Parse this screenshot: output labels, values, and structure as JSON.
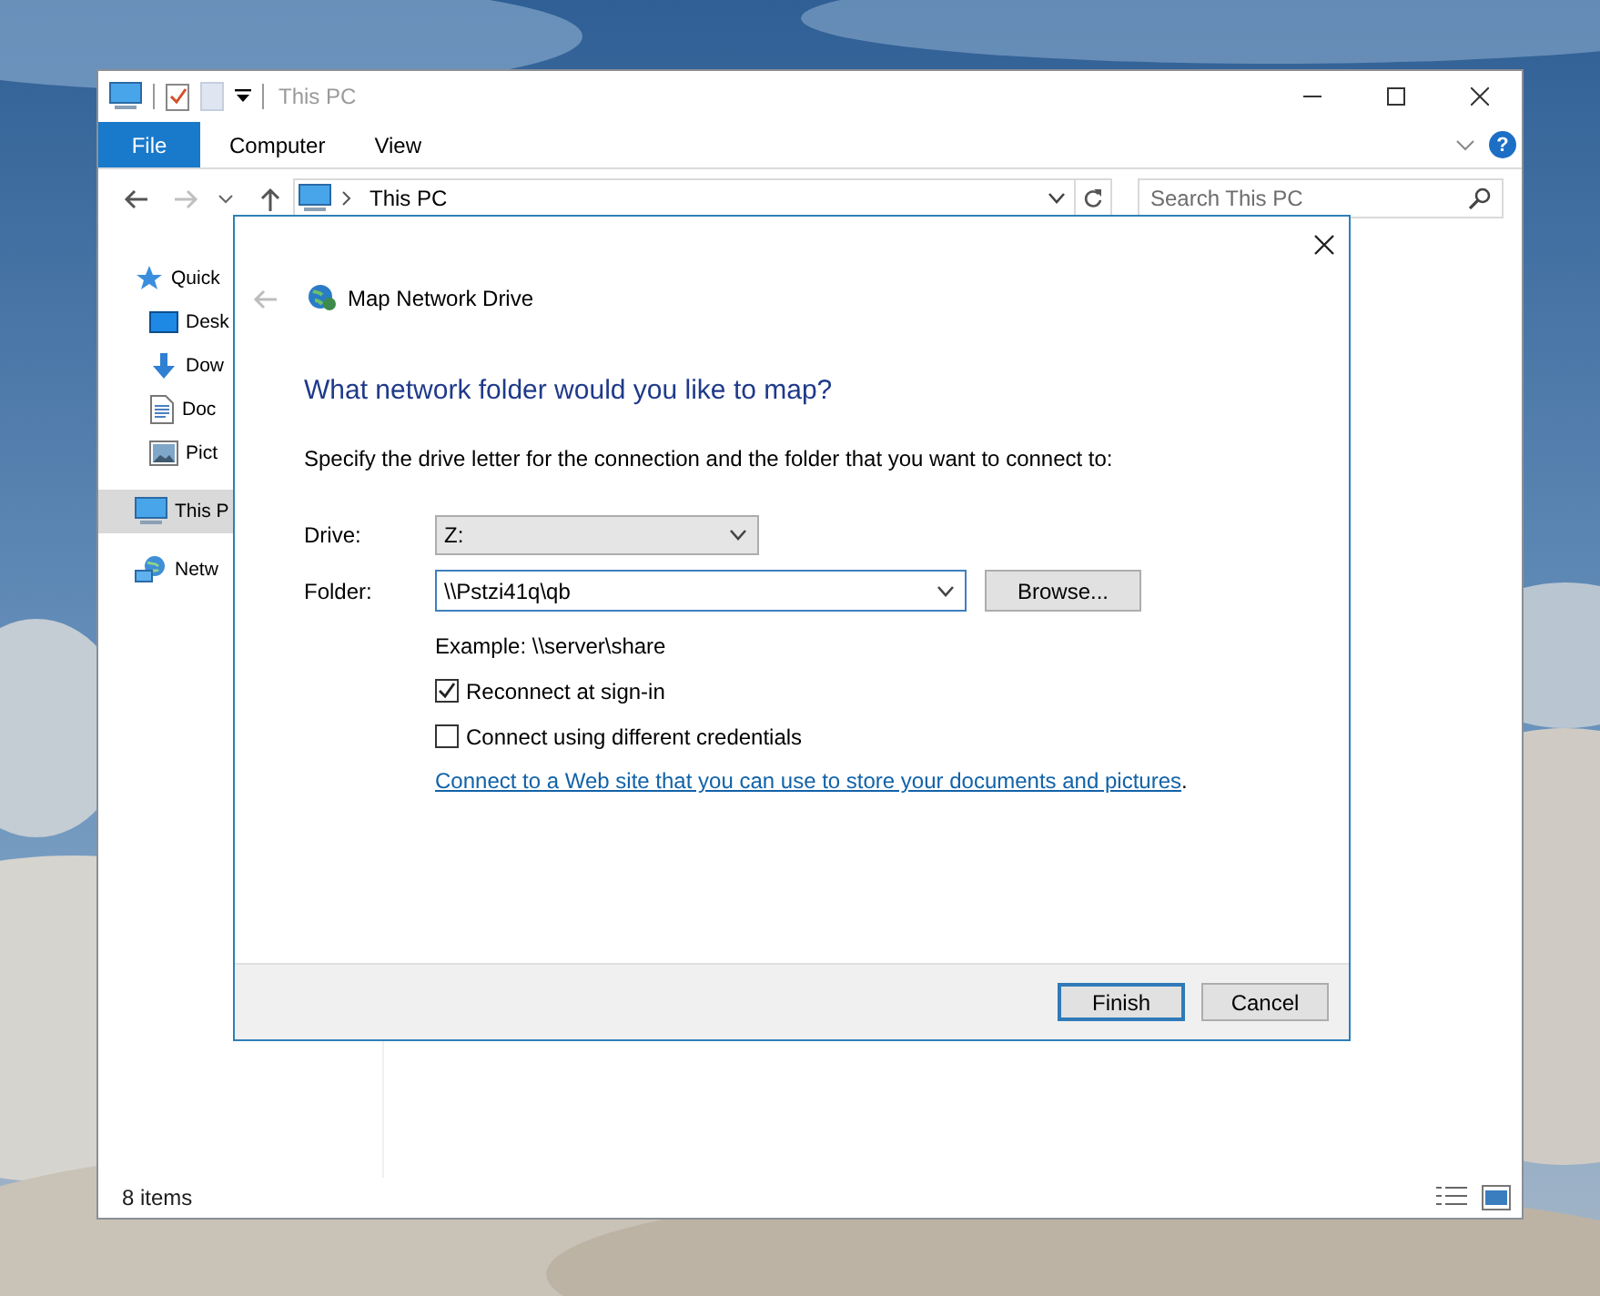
{
  "window": {
    "title": "This PC",
    "ribbon_tabs": [
      {
        "label": "File",
        "kind": "backstage"
      },
      {
        "label": "Computer",
        "kind": "tab"
      },
      {
        "label": "View",
        "kind": "tab"
      }
    ],
    "help": "?",
    "address": {
      "location": "This PC"
    },
    "search": {
      "placeholder": "Search This PC"
    },
    "sidebar": {
      "items": [
        {
          "label": "Quick",
          "kind": "quick",
          "selected": false,
          "children": [
            {
              "label": "Desk",
              "kind": "desktop",
              "selected": false
            },
            {
              "label": "Dow",
              "kind": "downloads",
              "selected": false
            },
            {
              "label": "Doc",
              "kind": "documents",
              "selected": false
            },
            {
              "label": "Pict",
              "kind": "pictures",
              "selected": false
            }
          ]
        },
        {
          "label": "This P",
          "kind": "pc",
          "selected": true
        },
        {
          "label": "Netw",
          "kind": "network",
          "selected": false
        }
      ]
    },
    "status_bar": {
      "count": "8 items"
    }
  },
  "dialog": {
    "title": "Map Network Drive",
    "heading": "What network folder would you like to map?",
    "instruction": "Specify the drive letter for the connection and the folder that you want to connect to:",
    "drive": {
      "label": "Drive:",
      "value": "Z:"
    },
    "folder": {
      "label": "Folder:",
      "value": "\\\\Pstzi41q\\qb"
    },
    "browse": "Browse...",
    "example": "Example: \\\\server\\share",
    "options": [
      {
        "label": "Reconnect at sign-in",
        "checked": true
      },
      {
        "label": "Connect using different credentials",
        "checked": false
      }
    ],
    "link": "Connect to a Web site that you can use to store your documents and pictures",
    "link_suffix": ".",
    "buttons": [
      {
        "label": "Finish",
        "default": true
      },
      {
        "label": "Cancel",
        "default": false
      }
    ]
  }
}
